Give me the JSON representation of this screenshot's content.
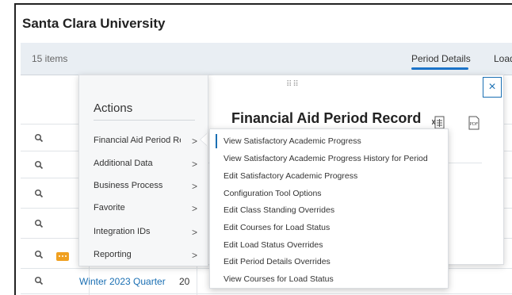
{
  "header": {
    "title": "Santa Clara University"
  },
  "grid": {
    "items_count": "15 items",
    "tabs": [
      {
        "label": "Period Details",
        "active": true
      },
      {
        "label": "Load"
      }
    ],
    "last_row": {
      "term": "Winter 2023 Quarter",
      "col2": "20"
    }
  },
  "actions": {
    "title": "Actions",
    "items": [
      {
        "label": "Financial Aid Period Re..."
      },
      {
        "label": "Additional Data"
      },
      {
        "label": "Business Process"
      },
      {
        "label": "Favorite"
      },
      {
        "label": "Integration IDs"
      },
      {
        "label": "Reporting"
      }
    ],
    "chevron": ">"
  },
  "record": {
    "title": "Financial Aid Period Record",
    "close": "×",
    "drag": "⠿⠿",
    "excel_icon": "excel-export-icon",
    "pdf_icon": "pdf-export-icon",
    "pdf_label": "PDF"
  },
  "submenu": {
    "items": [
      {
        "label": "View Satisfactory Academic Progress"
      },
      {
        "label": "View Satisfactory Academic Progress History for Period"
      },
      {
        "label": "Edit Satisfactory Academic Progress"
      },
      {
        "label": "Configuration Tool Options"
      },
      {
        "label": "Edit Class Standing Overrides"
      },
      {
        "label": "Edit Courses for Load Status"
      },
      {
        "label": "Edit Load Status Overrides"
      },
      {
        "label": "Edit Period Details Overrides"
      },
      {
        "label": "View Courses for Load Status"
      }
    ]
  },
  "colors": {
    "accent": "#1a6fb3",
    "more_button": "#f0a020",
    "header_bg": "#e9eef3"
  }
}
